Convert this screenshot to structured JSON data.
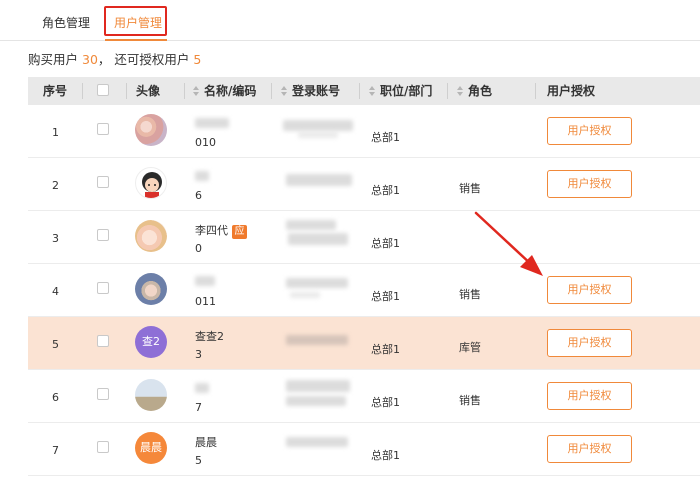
{
  "tabs": {
    "roles": "角色管理",
    "users": "用户管理"
  },
  "summary": {
    "purchased_label": "购买用户",
    "purchased_count": "30",
    "separator": "，",
    "remaining_label": "还可授权用户",
    "remaining_count": "5"
  },
  "columns": {
    "index": "序号",
    "select": "",
    "avatar": "头像",
    "name": "名称/编码",
    "account": "登录账号",
    "dept": "职位/部门",
    "role": "角色",
    "auth": "用户授权"
  },
  "rows": [
    {
      "index": "1",
      "name": "",
      "code": "010",
      "dept": "总部1",
      "role": "",
      "auth": "用户授权",
      "avatar": "photo-avatar-1",
      "badge": ""
    },
    {
      "index": "2",
      "name": "",
      "code": "6",
      "dept": "总部1",
      "role": "销售",
      "auth": "用户授权",
      "avatar": "cartoon-avatar",
      "badge": ""
    },
    {
      "index": "3",
      "name": "李四代",
      "code": "0",
      "dept": "总部1",
      "role": "",
      "auth": "",
      "avatar": "anime-avatar",
      "badge": "应"
    },
    {
      "index": "4",
      "name": "",
      "code": "011",
      "dept": "总部1",
      "role": "销售",
      "auth": "用户授权",
      "avatar": "photo-avatar-4",
      "badge": ""
    },
    {
      "index": "5",
      "name": "查查2",
      "code": "3",
      "dept": "总部1",
      "role": "库管",
      "auth": "用户授权",
      "avatar": "查2",
      "badge": ""
    },
    {
      "index": "6",
      "name": "",
      "code": "7",
      "dept": "总部1",
      "role": "销售",
      "auth": "用户授权",
      "avatar": "photo-avatar-6",
      "badge": ""
    },
    {
      "index": "7",
      "name": "晨晨",
      "code": "5",
      "dept": "总部1",
      "role": "",
      "auth": "用户授权",
      "avatar": "晨晨",
      "badge": ""
    }
  ],
  "colors": {
    "accent": "#f0893a",
    "selected_row": "#fbe3d3",
    "highlight_box": "#e0281f",
    "arrow": "#e0281f",
    "avatar_purple": "#8e6fd6",
    "avatar_orange": "#f5883a"
  }
}
